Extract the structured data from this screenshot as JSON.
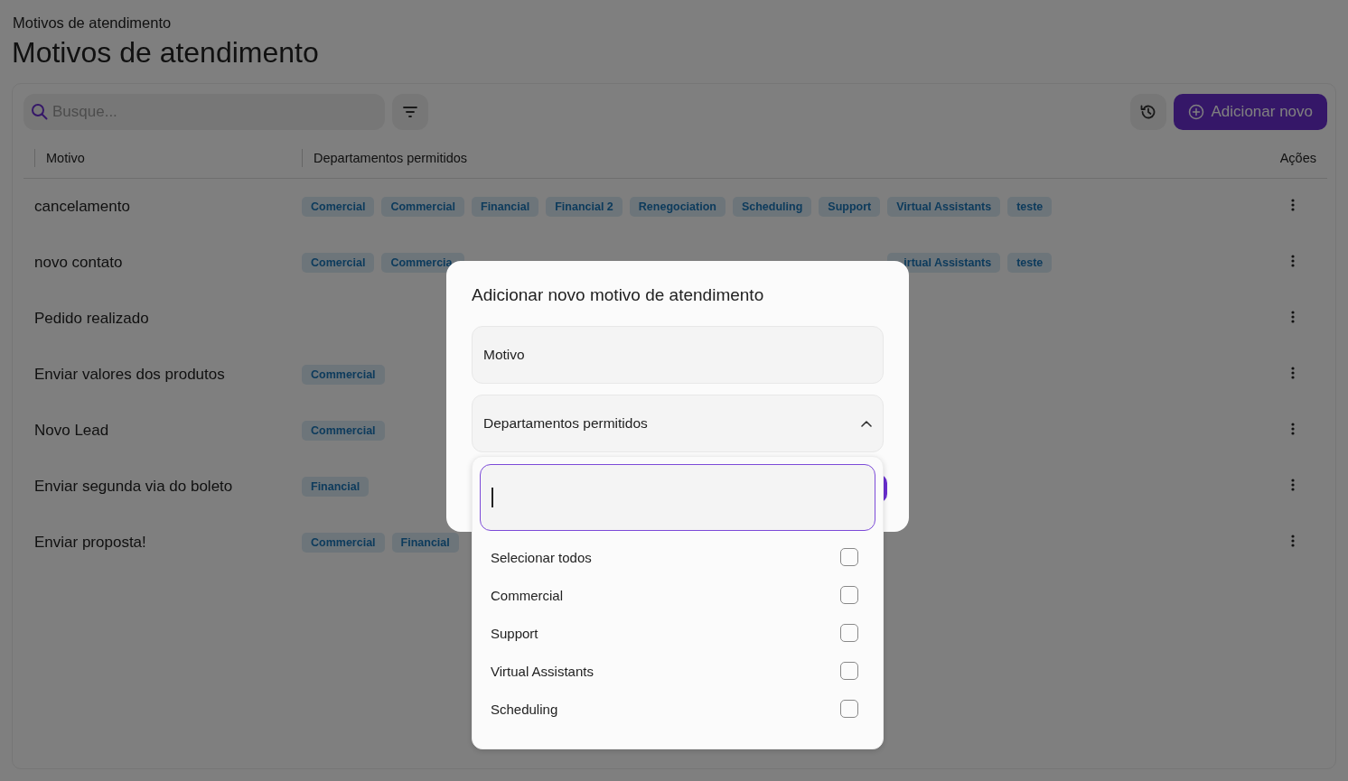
{
  "breadcrumb": "Motivos de atendimento",
  "title": "Motivos de atendimento",
  "search": {
    "placeholder": "Busque..."
  },
  "add_button": "Adicionar novo",
  "table": {
    "columns": [
      "Motivo",
      "Departamentos permitidos",
      "Ações"
    ],
    "rows": [
      {
        "motivo": "cancelamento",
        "departments": [
          "Comercial",
          "Commercial",
          "Financial",
          "Financial 2",
          "Renegociation",
          "Scheduling",
          "Support",
          "Virtual Assistants",
          "teste"
        ]
      },
      {
        "motivo": "novo contato",
        "departments": [
          "Comercial",
          "Commercia"
        ],
        "departments_right_of_dialog": [
          "irtual Assistants",
          "teste"
        ]
      },
      {
        "motivo": "Pedido realizado",
        "departments": []
      },
      {
        "motivo": "Enviar valores dos produtos",
        "departments": [
          "Commercial"
        ]
      },
      {
        "motivo": "Novo Lead",
        "departments": [
          "Commercial"
        ]
      },
      {
        "motivo": "Enviar segunda via do boleto",
        "departments": [
          "Financial"
        ]
      },
      {
        "motivo": "Enviar proposta!",
        "departments": [
          "Commercial",
          "Financial"
        ]
      }
    ]
  },
  "dialog": {
    "title": "Adicionar novo motivo de atendimento",
    "fields": [
      {
        "kind": "text",
        "label": "Motivo"
      },
      {
        "kind": "select",
        "label": "Departamentos permitidos",
        "expanded": true
      }
    ]
  },
  "dropdown": {
    "options": [
      {
        "label": "Selecionar todos",
        "checked": false
      },
      {
        "label": "Commercial",
        "checked": false
      },
      {
        "label": "Support",
        "checked": false
      },
      {
        "label": "Virtual Assistants",
        "checked": false
      },
      {
        "label": "Scheduling",
        "checked": false
      }
    ]
  }
}
